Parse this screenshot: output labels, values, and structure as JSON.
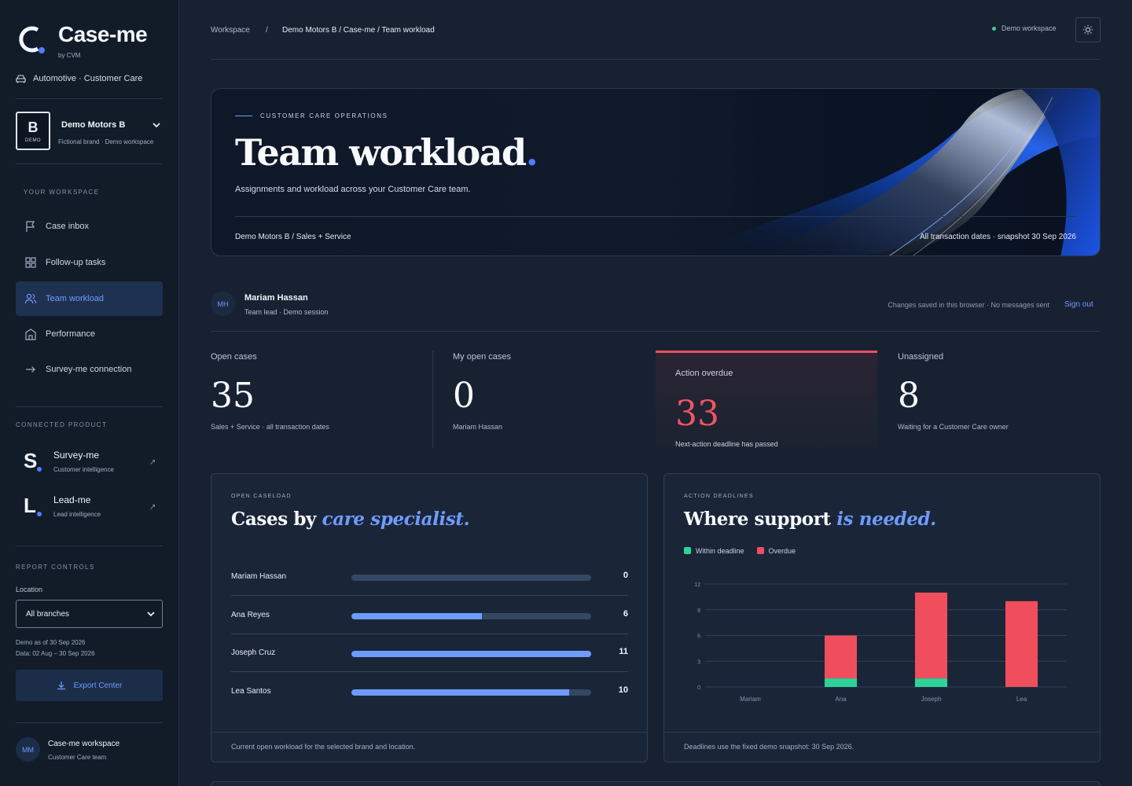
{
  "app": {
    "logo_title": "Case-me",
    "logo_sub": "by CVM",
    "industry": "Automotive · Customer Care"
  },
  "brand": {
    "box_letter": "B",
    "box_tag": "DEMO",
    "name": "Demo Motors B",
    "sub": "Fictional brand · Demo workspace"
  },
  "nav": {
    "section_label": "YOUR WORKSPACE",
    "items": [
      {
        "label": "Case inbox",
        "icon": "flag-icon"
      },
      {
        "label": "Follow-up tasks",
        "icon": "grid-icon"
      },
      {
        "label": "Team workload",
        "icon": "users-icon",
        "active": true
      },
      {
        "label": "Performance",
        "icon": "building-icon"
      },
      {
        "label": "Survey-me connection",
        "icon": "arrow-right-icon"
      }
    ]
  },
  "products": {
    "section_label": "CONNECTED PRODUCT",
    "items": [
      {
        "letter": "S",
        "name": "Survey-me",
        "sub": "Customer intelligence"
      },
      {
        "letter": "L",
        "name": "Lead-me",
        "sub": "Lead intelligence"
      }
    ]
  },
  "report": {
    "section_label": "REPORT CONTROLS",
    "location_label": "Location",
    "location_value": "All branches",
    "demo_as_of": "Demo as of 30 Sep 2026",
    "data_range": "Data: 02 Aug – 30 Sep 2026",
    "export_label": "Export Center"
  },
  "workspace_user": {
    "initials": "MM",
    "name": "Case-me workspace",
    "sub": "Customer Care team"
  },
  "topbar": {
    "crumb_root": "Workspace",
    "crumb_sep": "/",
    "crumb_current": "Demo Motors B / Case-me / Team workload",
    "workspace_pill": "Demo workspace"
  },
  "hero": {
    "kicker": "CUSTOMER CARE OPERATIONS",
    "title": "Team workload",
    "title_dot": ".",
    "description": "Assignments and workload across your Customer Care team.",
    "footer_left": "Demo Motors B / Sales + Service",
    "footer_right": "All transaction dates · snapshot 30 Sep 2026"
  },
  "session": {
    "initials": "MH",
    "name": "Mariam Hassan",
    "role": "Team lead · Demo session",
    "saved_note": "Changes saved in this browser · No messages sent",
    "signout": "Sign out"
  },
  "kpis": [
    {
      "label": "Open cases",
      "value": "35",
      "sub": "Sales + Service · all transaction dates"
    },
    {
      "label": "My open cases",
      "value": "0",
      "sub": "Mariam Hassan"
    },
    {
      "label": "Action overdue",
      "value": "33",
      "sub": "Next-action deadline has passed",
      "alert": true
    },
    {
      "label": "Unassigned",
      "value": "8",
      "sub": "Waiting for a Customer Care owner"
    }
  ],
  "caseload": {
    "kicker": "OPEN CASELOAD",
    "title_plain": "Cases by ",
    "title_em": "care specialist.",
    "max": 11,
    "rows": [
      {
        "name": "Mariam Hassan",
        "value": 0
      },
      {
        "name": "Ana Reyes",
        "value": 6
      },
      {
        "name": "Joseph Cruz",
        "value": 11
      },
      {
        "name": "Lea Santos",
        "value": 10
      }
    ],
    "footer": "Current open workload for the selected brand and location."
  },
  "deadlines": {
    "kicker": "ACTION DEADLINES",
    "title_plain": "Where support ",
    "title_em": "is needed.",
    "legend": [
      {
        "label": "Within deadline",
        "color": "#2ed39a"
      },
      {
        "label": "Overdue",
        "color": "#f04e5d"
      }
    ],
    "footer": "Deadlines use the fixed demo snapshot: 30 Sep 2026."
  },
  "chart_data": {
    "type": "bar",
    "stacked": true,
    "categories": [
      "Mariam",
      "Ana",
      "Joseph",
      "Lea"
    ],
    "series": [
      {
        "name": "Within deadline",
        "color": "#2ed39a",
        "values": [
          0,
          1,
          1,
          0
        ]
      },
      {
        "name": "Overdue",
        "color": "#f04e5d",
        "values": [
          0,
          5,
          10,
          10
        ]
      }
    ],
    "yticks": [
      0,
      3,
      6,
      9,
      12
    ],
    "ylim": [
      0,
      12
    ],
    "grid": true,
    "legend_position": "top-left"
  }
}
